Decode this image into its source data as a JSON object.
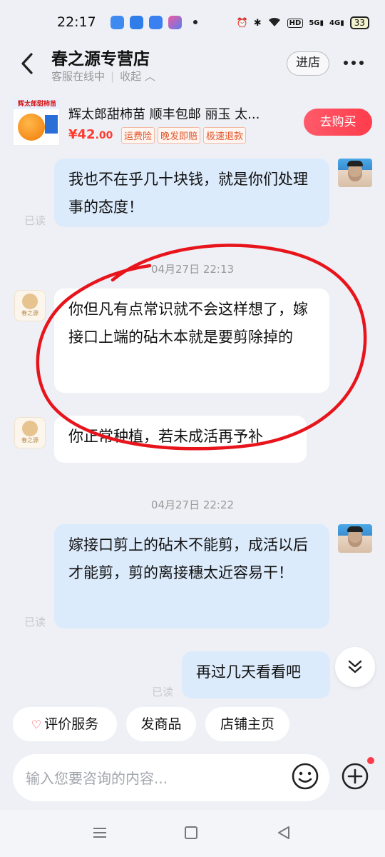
{
  "status_bar": {
    "time": "22:17",
    "network": "5G",
    "signal_label": "4G",
    "hd_label": "HD",
    "battery": "33"
  },
  "header": {
    "shop_name": "春之源专营店",
    "status": "客服在线中",
    "collapse": "收起",
    "enter_shop": "进店"
  },
  "product": {
    "thumb_title": "辉太郎甜柿苗",
    "title": "辉太郎甜柿苗 顺丰包邮 丽玉 太...",
    "price_symbol": "¥",
    "price_int": "42",
    "price_dec": ".00",
    "tags": [
      "运费险",
      "晚发即赔",
      "极速退款"
    ],
    "buy_label": "去购买"
  },
  "messages": {
    "m1": "我也不在乎几十块钱，就是你们处理事的态度！",
    "read1": "已读",
    "ts1": "04月27日 22:13",
    "m2": "你但凡有点常识就不会这样想了，嫁接口上端的砧木本就是要剪除掉的",
    "m3": "你正常种植，若未成活再予补",
    "ts2": "04月27日 22:22",
    "m4": "嫁接口剪上的砧木不能剪，成活以后才能剪，剪的离接穗太近容易干！",
    "read2": "已读",
    "m5": "再过几天看看吧",
    "read3": "已读",
    "shop_avatar_text": "春之源"
  },
  "quick_actions": {
    "rate": "评价服务",
    "send_product": "发商品",
    "shop_home": "店铺主页"
  },
  "input": {
    "placeholder": "输入您要咨询的内容..."
  },
  "colors": {
    "accent_red": "#ff3c4b",
    "bubble_me": "#dcebfc",
    "annotation": "#e8141c"
  }
}
